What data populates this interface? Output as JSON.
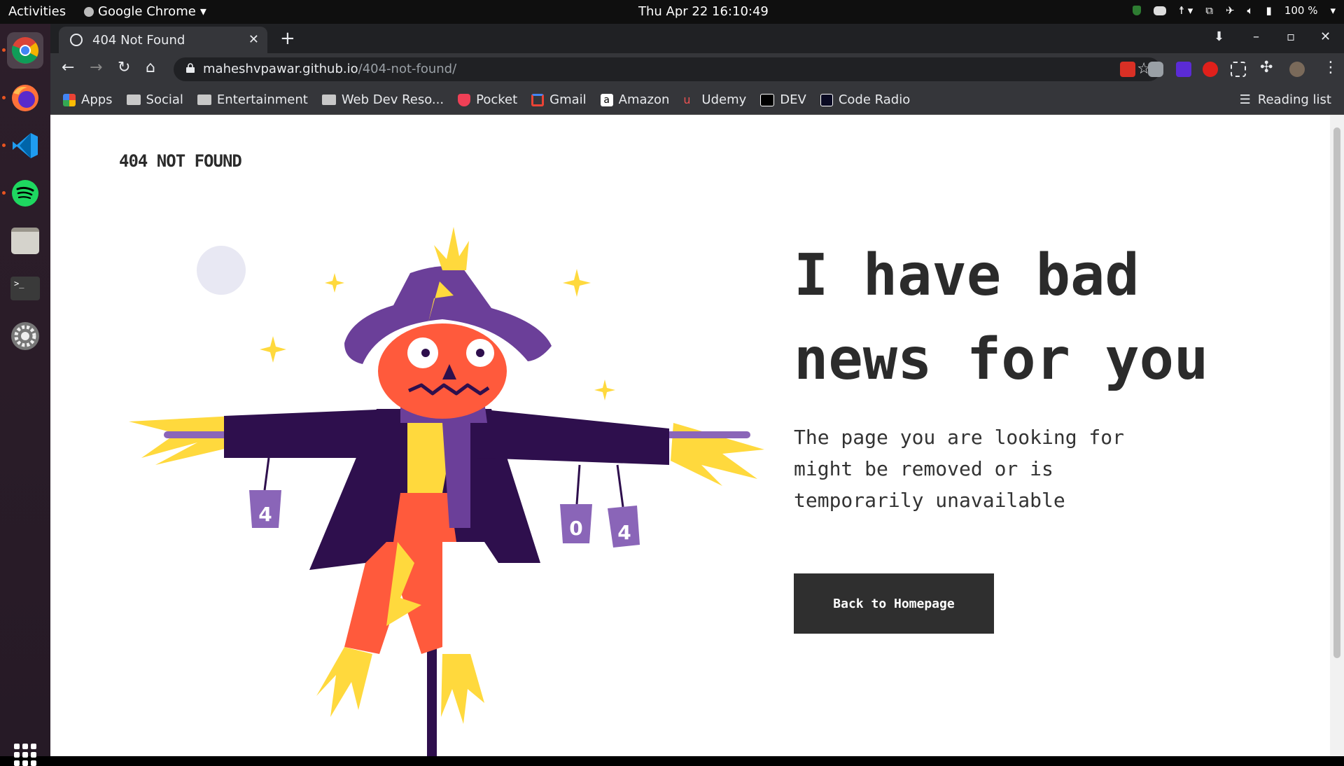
{
  "topbar": {
    "activities": "Activities",
    "app_name": "Google Chrome",
    "clock": "Thu Apr 22  16:10:49",
    "battery": "100 %"
  },
  "browser": {
    "tab_title": "404 Not Found",
    "url_host": "maheshvpawar.github.io",
    "url_path": "/404-not-found/",
    "bookmarks": [
      "Apps",
      "Social",
      "Entertainment",
      "Web Dev Reso...",
      "Pocket",
      "Gmail",
      "Amazon",
      "Udemy",
      "DEV",
      "Code Radio"
    ],
    "reading_list": "Reading list"
  },
  "page": {
    "logo": "404 NOT FOUND",
    "headline_line1": "I have bad",
    "headline_line2": "news for you",
    "subtext": "The page you are looking for might be removed or is temporarily unavailable",
    "button": "Back to Homepage",
    "cans": [
      "4",
      "0",
      "4"
    ]
  },
  "colors": {
    "hat": "#6b3f99",
    "coat": "#2e0f4d",
    "pumpkin": "#ff5a3c",
    "straw": "#ffd93d",
    "dark_text": "#2b2b2b"
  }
}
